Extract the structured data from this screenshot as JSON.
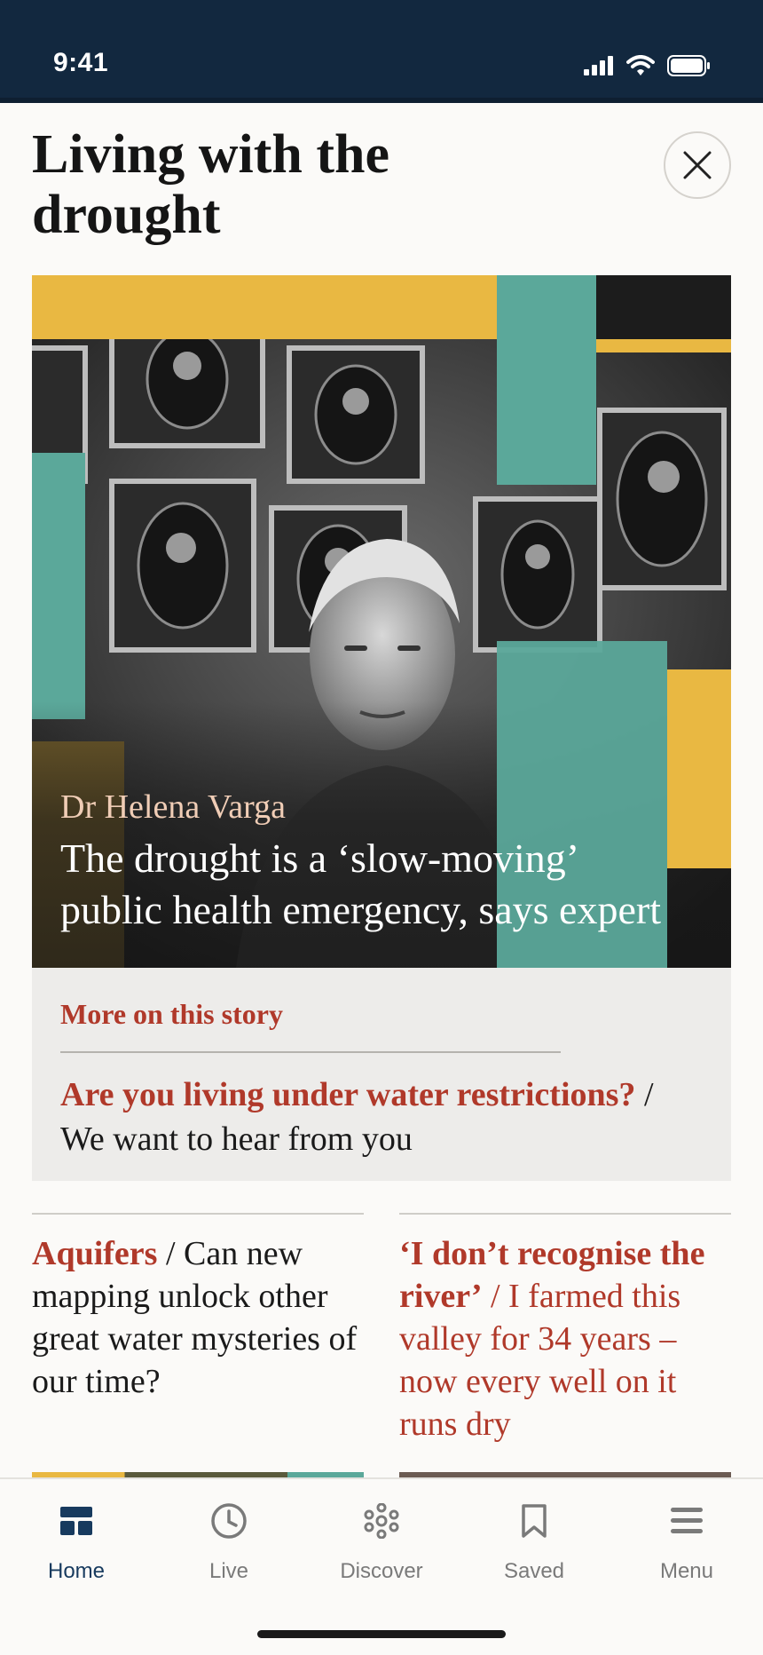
{
  "status_bar": {
    "time": "9:41"
  },
  "header": {
    "title": "Living with the drought",
    "close_icon": "close-icon"
  },
  "hero": {
    "kicker": "Dr Helena Varga",
    "headline": "The drought is a ‘slow-moving’ public health emergency, says expert",
    "colors": {
      "gold": "#e9b842",
      "teal": "#5ba89a"
    }
  },
  "more_on_story": {
    "label": "More on this story",
    "link_strong": "Are you living under water restrictions?",
    "link_rest": "/ We want to hear from you"
  },
  "cards": [
    {
      "kicker": "Aquifers",
      "text": "/ Can new mapping unlock other great water mysteries of our time?"
    },
    {
      "kicker": "‘I don’t recognise the river’",
      "text": "/ I farmed this valley for 34 years – now every well on it runs dry"
    }
  ],
  "tab_bar": {
    "tabs": [
      {
        "label": "Home",
        "icon": "home-icon",
        "active": true
      },
      {
        "label": "Live",
        "icon": "clock-icon",
        "active": false
      },
      {
        "label": "Discover",
        "icon": "discover-icon",
        "active": false
      },
      {
        "label": "Saved",
        "icon": "bookmark-icon",
        "active": false
      },
      {
        "label": "Menu",
        "icon": "menu-icon",
        "active": false
      }
    ]
  },
  "colors": {
    "accent_red": "#b0392a",
    "navy": "#12283f",
    "active_tab": "#173a5e"
  }
}
